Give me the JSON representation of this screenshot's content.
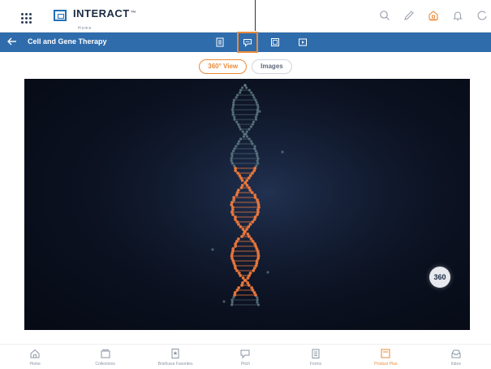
{
  "header": {
    "logo_text": "INTERACT",
    "logo_tm": "™",
    "logo_sub": "Home"
  },
  "navbar": {
    "title": "Cell and Gene Therapy",
    "back_icon": "back-arrow-icon"
  },
  "view_toggle": {
    "options": [
      {
        "label": "360° View",
        "active": true
      },
      {
        "label": "Images",
        "active": false
      }
    ]
  },
  "viewer": {
    "badge_label": "360"
  },
  "bottom_nav": [
    {
      "label": "Home",
      "icon": "home-icon",
      "active": false
    },
    {
      "label": "Collections",
      "icon": "collections-icon",
      "active": false
    },
    {
      "label": "Briefcase Favorites",
      "icon": "bookmark-icon",
      "active": false
    },
    {
      "label": "Pitch",
      "icon": "pitch-icon",
      "active": false
    },
    {
      "label": "Forms",
      "icon": "forms-icon",
      "active": false
    },
    {
      "label": "Product Plus",
      "icon": "product-plus-icon",
      "active": true
    },
    {
      "label": "Inbox",
      "icon": "inbox-icon",
      "active": false
    }
  ],
  "colors": {
    "brand_blue": "#2f6cac",
    "accent_orange": "#e98a3a",
    "dna_orange": "#f07a3c",
    "dna_teal": "#6f8e96"
  }
}
